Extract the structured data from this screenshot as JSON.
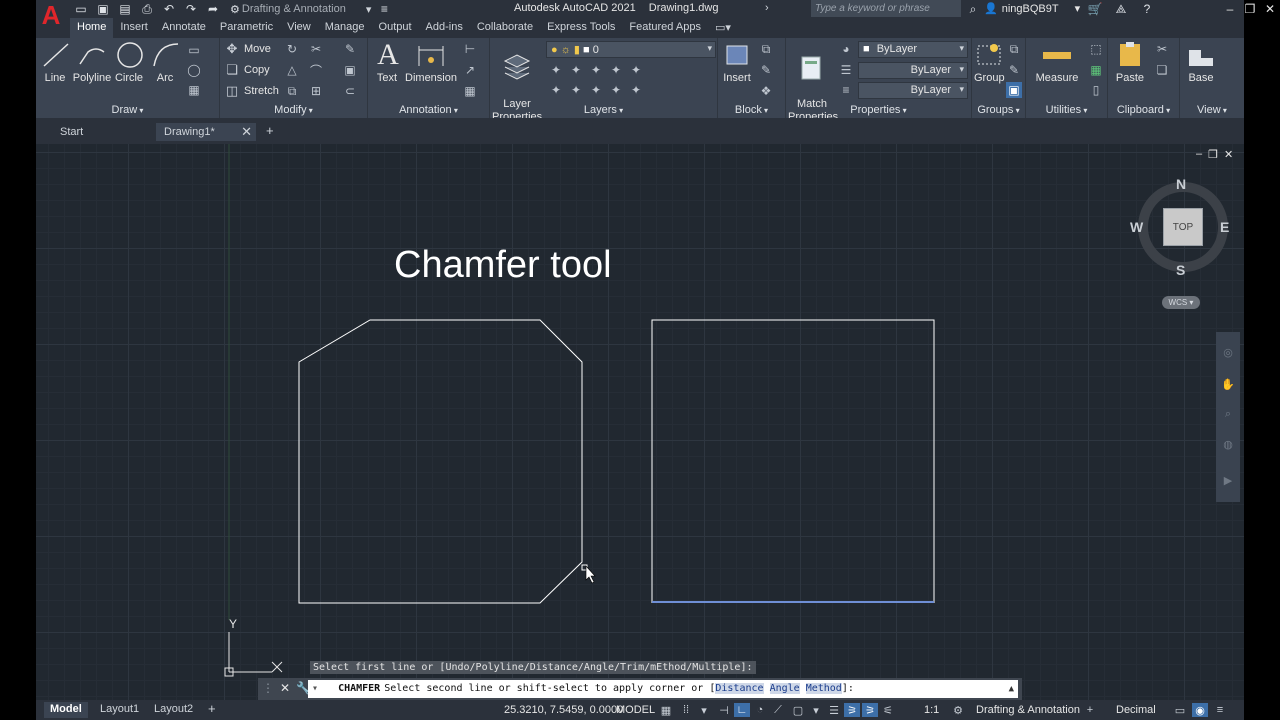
{
  "titlebar": {
    "logo": "A",
    "workspace": "Drafting & Annotation",
    "app_name": "Autodesk AutoCAD 2021",
    "file_name": "Drawing1.dwg",
    "search_placeholder": "Type a keyword or phrase",
    "user": "ningBQB9T"
  },
  "ribbon_tabs": [
    "Home",
    "Insert",
    "Annotate",
    "Parametric",
    "View",
    "Manage",
    "Output",
    "Add-ins",
    "Collaborate",
    "Express Tools",
    "Featured Apps"
  ],
  "ribbon": {
    "draw": {
      "title": "Draw",
      "line": "Line",
      "polyline": "Polyline",
      "circle": "Circle",
      "arc": "Arc"
    },
    "modify": {
      "title": "Modify",
      "move": "Move",
      "copy": "Copy",
      "stretch": "Stretch"
    },
    "annotation": {
      "title": "Annotation",
      "text": "Text",
      "dimension": "Dimension"
    },
    "layers": {
      "title": "Layers",
      "layer_properties": "Layer\nProperties",
      "current_layer": "0"
    },
    "block": {
      "title": "Block",
      "insert": "Insert"
    },
    "properties": {
      "title": "Properties",
      "match": "Match\nProperties",
      "color": "ByLayer",
      "linetype": "ByLayer",
      "lineweight": "ByLayer"
    },
    "groups": {
      "title": "Groups",
      "group": "Group"
    },
    "utilities": {
      "title": "Utilities",
      "measure": "Measure"
    },
    "clipboard": {
      "title": "Clipboard",
      "paste": "Paste"
    },
    "view": {
      "title": "View",
      "base": "Base"
    }
  },
  "doc_tabs": {
    "start": "Start",
    "drawing": "Drawing1*"
  },
  "canvas": {
    "heading": "Chamfer tool",
    "viewcube": {
      "n": "N",
      "s": "S",
      "e": "E",
      "w": "W",
      "top": "TOP",
      "wcs": "WCS"
    },
    "ucs_y": "Y"
  },
  "command": {
    "history": "Select first line or [Undo/Polyline/Distance/Angle/Trim/mEthod/Multiple]:",
    "name": "CHAMFER",
    "prompt": "Select second line or shift-select to apply corner or [",
    "opt1": "Distance",
    "opt2": "Angle",
    "opt3": "Method",
    "suffix": "]:"
  },
  "statusbar": {
    "layouts": [
      "Model",
      "Layout1",
      "Layout2"
    ],
    "coords": "25.3210, 7.5459, 0.0000",
    "space": "MODEL",
    "scale": "1:1",
    "workspace": "Drafting & Annotation",
    "units": "Decimal"
  },
  "colors": {
    "canvas_bg": "#212830",
    "ribbon_bg": "#3b4452",
    "chrome_bg": "#2b313b",
    "geometry": "#ffffff",
    "selection_highlight": "#6f8fd6",
    "logo_red": "#e0262b"
  }
}
